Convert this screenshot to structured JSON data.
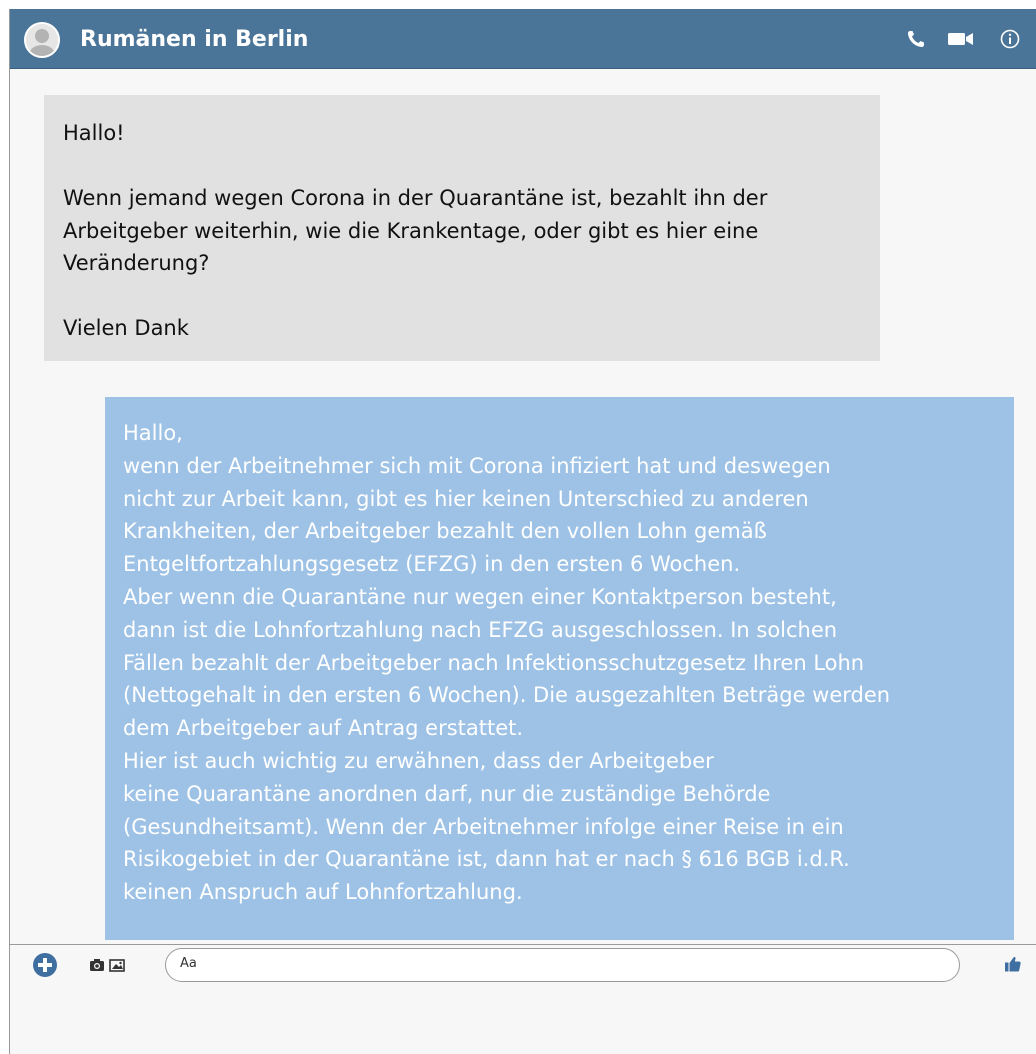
{
  "header": {
    "title": "Rumänen in Berlin",
    "colors": {
      "bar": "#4b7598",
      "text": "#ffffff"
    },
    "icons": [
      "avatar-icon",
      "phone-icon",
      "video-icon",
      "info-icon"
    ]
  },
  "messages": {
    "incoming": {
      "text": "Hallo!\n\nWenn jemand wegen Corona in der Quarantäne ist, bezahlt ihn der\nArbeitgeber weiterhin, wie die Krankentage, oder gibt es hier eine\nVeränderung?\n\nVielen Dank",
      "background": "#e1e1e1"
    },
    "outgoing": {
      "text": "Hallo,\nwenn der Arbeitnehmer sich mit Corona infiziert hat und deswegen\nnicht zur Arbeit kann, gibt es hier keinen Unterschied zu anderen\nKrankheiten, der Arbeitgeber bezahlt den vollen Lohn gemäß\nEntgeltfortzahlungsgesetz (EFZG) in den ersten 6 Wochen.\nAber wenn die Quarantäne nur wegen einer Kontaktperson besteht,\ndann ist die Lohnfortzahlung nach EFZG ausgeschlossen. In solchen\nFällen bezahlt der Arbeitgeber nach Infektionsschutzgesetz Ihren Lohn\n(Nettogehalt in den ersten 6 Wochen). Die ausgezahlten Beträge werden\ndem Arbeitgeber auf Antrag erstattet.\nHier ist auch wichtig zu erwähnen, dass der Arbeitgeber\nkeine Quarantäne anordnen darf, nur die zuständige Behörde\n(Gesundheitsamt). Wenn der Arbeitnehmer infolge einer Reise in ein\nRisikogebiet in der Quarantäne ist, dann hat er nach § 616 BGB i.d.R.\nkeinen Anspruch auf Lohnfortzahlung.",
      "background": "#9dc2e6"
    }
  },
  "composer": {
    "placeholder": "Aa",
    "icons": [
      "plus-icon",
      "camera-icon",
      "photo-icon",
      "thumbs-up-icon"
    ]
  }
}
